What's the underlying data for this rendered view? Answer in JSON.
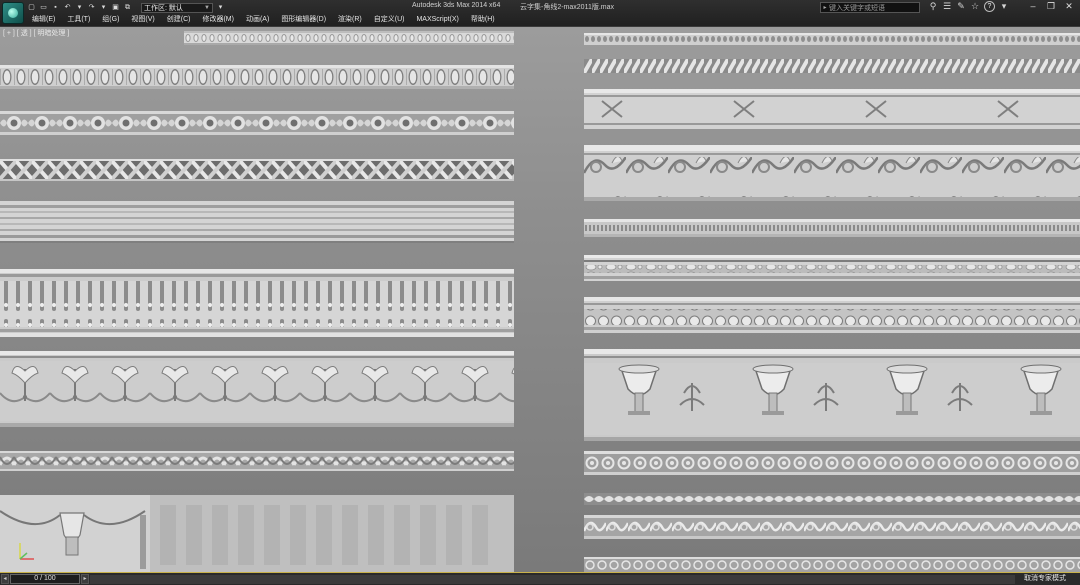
{
  "titlebar": {
    "workspace_label": "工作区: 默认",
    "app_title": "Autodesk 3ds Max  2014 x64",
    "file_title": "云字集-角线2-max2011版.max",
    "search_placeholder": "键入关键字或短语"
  },
  "menu": {
    "items": [
      "编辑(E)",
      "工具(T)",
      "组(G)",
      "视图(V)",
      "创建(C)",
      "修改器(M)",
      "动画(A)",
      "图形编辑器(D)",
      "渲染(R)",
      "自定义(U)",
      "MAXScript(X)",
      "帮助(H)"
    ]
  },
  "viewport": {
    "label": "[ + ] [ 透 ] [ 明暗处理 ]"
  },
  "timebar": {
    "counter": "0 / 100",
    "status": "取消专家模式"
  },
  "colors": {
    "accent": "#c9b24a",
    "viewport_top": "#9c9c9c",
    "viewport_bottom": "#7a7a7a"
  }
}
